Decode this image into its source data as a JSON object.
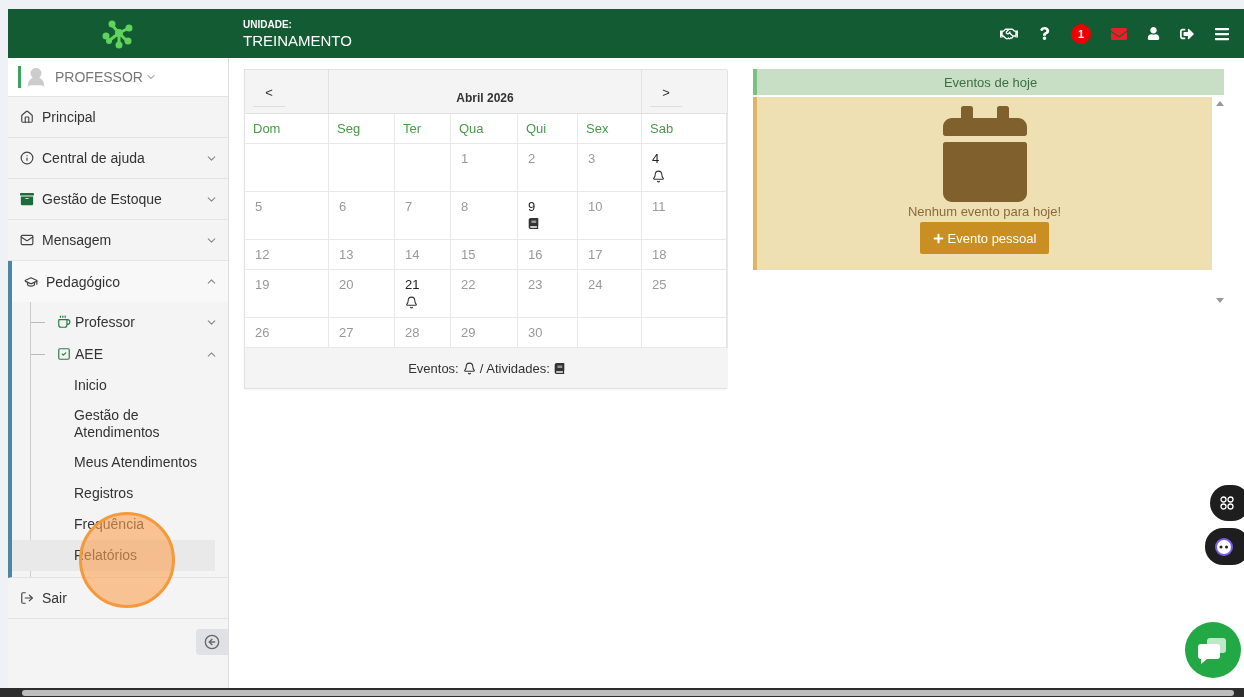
{
  "header": {
    "unit_label": "UNIDADE:",
    "unit_name": "TREINAMENTO",
    "notification_count": "1"
  },
  "user": {
    "role": "PROFESSOR"
  },
  "menu": [
    {
      "label": "Principal",
      "kind": "link"
    },
    {
      "label": "Central de ajuda",
      "kind": "group",
      "expanded": false
    },
    {
      "label": "Gestão de Estoque",
      "kind": "group",
      "expanded": false
    },
    {
      "label": "Mensagem",
      "kind": "group",
      "expanded": false
    },
    {
      "label": "Pedagógico",
      "kind": "group",
      "expanded": true,
      "children": [
        {
          "label": "Professor",
          "expanded": false
        },
        {
          "label": "AEE",
          "expanded": true,
          "children": [
            {
              "label": "Inicio",
              "selected": false
            },
            {
              "label": "Gestão de Atendimentos",
              "selected": false
            },
            {
              "label": "Meus Atendimentos",
              "selected": false
            },
            {
              "label": "Registros",
              "selected": false
            },
            {
              "label": "Frequência",
              "selected": false
            },
            {
              "label": "Relatórios",
              "selected": true
            }
          ]
        }
      ]
    },
    {
      "label": "Sair",
      "kind": "link"
    }
  ],
  "calendar": {
    "prev": "<",
    "title": "Abril 2026",
    "next": ">",
    "weekdays": [
      "Dom",
      "Seg",
      "Ter",
      "Qua",
      "Qui",
      "Sex",
      "Sab"
    ],
    "weeks": [
      {
        "kind": "first",
        "days": [
          {
            "day": "1",
            "kind": "plain"
          },
          {
            "day": "2",
            "kind": "plain"
          },
          {
            "day": "3",
            "kind": "plain"
          },
          {
            "day": "4",
            "kind": "event"
          }
        ]
      },
      {
        "days": [
          {
            "day": "5",
            "kind": "plain"
          },
          {
            "day": "6",
            "kind": "plain"
          },
          {
            "day": "7",
            "kind": "plain"
          },
          {
            "day": "8",
            "kind": "plain"
          },
          {
            "day": "9",
            "kind": "activity"
          },
          {
            "day": "10",
            "kind": "plain"
          },
          {
            "day": "11",
            "kind": "plain"
          }
        ]
      },
      {
        "days": [
          {
            "day": "12",
            "kind": "plain"
          },
          {
            "day": "13",
            "kind": "plain"
          },
          {
            "day": "14",
            "kind": "plain"
          },
          {
            "day": "15",
            "kind": "plain"
          },
          {
            "day": "16",
            "kind": "plain"
          },
          {
            "day": "17",
            "kind": "plain"
          },
          {
            "day": "18",
            "kind": "plain"
          }
        ]
      },
      {
        "days": [
          {
            "day": "19",
            "kind": "plain"
          },
          {
            "day": "20",
            "kind": "plain"
          },
          {
            "day": "21",
            "kind": "event"
          },
          {
            "day": "22",
            "kind": "plain"
          },
          {
            "day": "23",
            "kind": "plain"
          },
          {
            "day": "24",
            "kind": "plain"
          },
          {
            "day": "25",
            "kind": "plain"
          }
        ]
      },
      {
        "kind": "last",
        "days": [
          {
            "day": "26",
            "kind": "plain"
          },
          {
            "day": "27",
            "kind": "plain"
          },
          {
            "day": "28",
            "kind": "plain"
          },
          {
            "day": "29",
            "kind": "plain"
          },
          {
            "day": "30",
            "kind": "plain"
          }
        ]
      }
    ],
    "legend": {
      "events_label": "Eventos:",
      "activities_label": "/ Atividades:"
    }
  },
  "today": {
    "title": "Eventos de hoje",
    "message": "Nenhum evento para hoje!",
    "button": "Evento pessoal"
  }
}
